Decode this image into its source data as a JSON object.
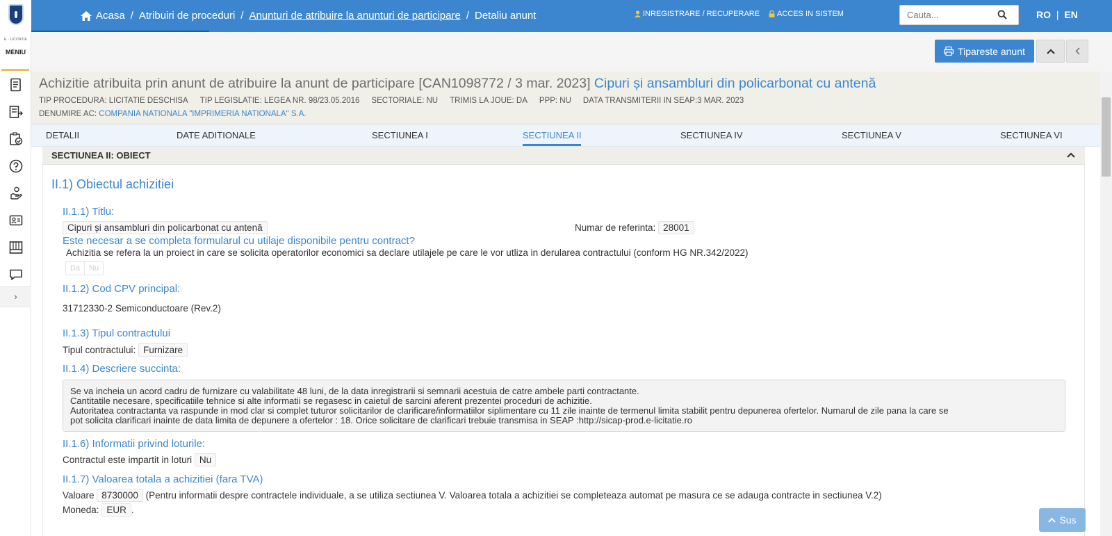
{
  "breadcrumb": {
    "home": "Acasa",
    "item1": "Atribuiri de proceduri",
    "item2": "Anunturi de atribuire la anunturi de participare",
    "current": "Detaliu anunt"
  },
  "auth": {
    "register": "INREGISTRARE / RECUPERARE",
    "login": "ACCES IN SISTEM"
  },
  "search": {
    "placeholder": "Cauta..."
  },
  "lang": {
    "ro": "RO",
    "sep": "|",
    "en": "EN"
  },
  "sidebar": {
    "brand": "E - LICITATIE",
    "menu_label": "MENIU",
    "icons": [
      "notice-icon",
      "export-list-icon",
      "checklist-icon",
      "help-icon",
      "hand-coin-icon",
      "id-card-icon",
      "catalog-icon",
      "chat-icon"
    ],
    "expand": "›"
  },
  "actions": {
    "print_label": "Tipareste anunt"
  },
  "header": {
    "title_main": "Achizitie atribuita prin anunt de atribuire la anunt de participare [CAN1098772 / 3 mar. 2023]",
    "title_accent": "Cipuri și ansambluri din policarbonat cu antenă",
    "meta": [
      "TIP PROCEDURA: LICITATIE DESCHISA",
      "TIP LEGISLATIE: LEGEA NR. 98/23.05.2016",
      "SECTORIALE: NU",
      "TRIMIS LA JOUE: DA",
      "PPP: NU",
      "DATA TRANSMITERII IN SEAP:3 MAR. 2023"
    ],
    "ac_label": "DENUMIRE AC:",
    "ac_value": "COMPANIA NATIONALA \"IMPRIMERIA NATIONALA\" S.A."
  },
  "tabs": [
    "DETALII",
    "DATE ADITIONALE",
    "SECTIUNEA I",
    "SECTIUNEA II",
    "SECTIUNEA IV",
    "SECTIUNEA V",
    "SECTIUNEA VI"
  ],
  "active_tab": "SECTIUNEA II",
  "section": {
    "header": "SECTIUNEA II: OBIECT",
    "h_main": "II.1) Obiectul achizitiei",
    "titlu_heading": "II.1.1) Titlu:",
    "titlu_value": "Cipuri și ansambluri din policarbonat cu antenă",
    "ref_label": "Numar de referinta:",
    "ref_value": "28001",
    "form_question": "Este necesar a se completa formularul cu utilaje disponibile pentru contract?",
    "form_answer": "Achizitia se refera la un proiect in care se solicita operatorilor economici sa declare utilajele pe care le vor utliza in derularea contractului (conform HG NR.342/2022)",
    "yes": "Da",
    "no": "Nu",
    "cpv_heading": "II.1.2) Cod CPV principal:",
    "cpv_value": "31712330-2 Semiconductoare (Rev.2)",
    "contract_type_heading": "II.1.3) Tipul contractului",
    "contract_type_label": "Tipul contractului:",
    "contract_type_value": "Furnizare",
    "desc_heading": "II.1.4) Descriere succinta:",
    "desc_lines": [
      "Se va incheia un acord cadru de furnizare cu valabilitate 48 luni, de la data inregistrarii si semnarii acestuia de catre ambele parti contractante.",
      "Cantitatile necesare, specificatiile tehnice si alte informatii se regasesc in caietul de sarcini aferent prezentei proceduri de achizitie.",
      "Autoritatea contractanta va raspunde in mod clar si complet tuturor solicitarilor de clarificare/informatiilor siplimentare cu 11 zile inainte de termenul limita stabilit pentru depunerea ofertelor. Numarul de zile pana la care se",
      "pot solicita clarificari inainte de data limita de depunere a ofertelor : 18. Orice solicitare de clarificari trebuie transmisa in SEAP :http://sicap-prod.e-licitatie.ro"
    ],
    "lots_heading": "II.1.6) Informatii privind loturile:",
    "lots_label": "Contractul este impartit in loturi",
    "lots_value": "Nu",
    "value_heading": "II.1.7) Valoarea totala a achizitiei (fara TVA)",
    "value_label": "Valoare",
    "value_amount": "8730000",
    "value_note": "(Pentru informatii despre contractele individuale, a se utiliza sectiunea V. Valoarea totala a achizitiei se completeaza automat pe masura ce se adauga contracte in sectiunea V.2)",
    "currency_label": "Moneda:",
    "currency_value": "EUR",
    "currency_suffix": "."
  },
  "back_to_top": "Sus",
  "colors": {
    "primary": "#3c86cf",
    "header_bg": "#f0efe8",
    "tabs_bg": "#eef4fb",
    "accent_bar": "#e7c24a"
  }
}
